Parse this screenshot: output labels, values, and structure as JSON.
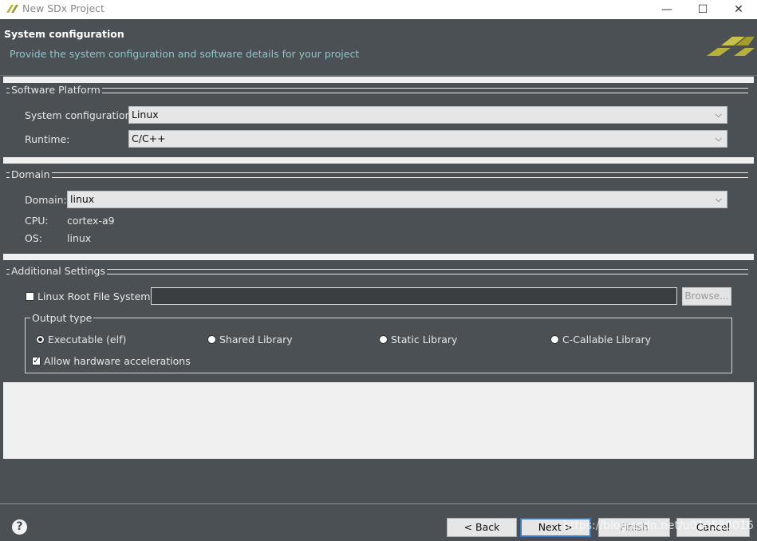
{
  "window": {
    "title": "New SDx Project",
    "minimize": "—",
    "maximize": "☐",
    "close": "✕"
  },
  "header": {
    "title": "System configuration",
    "description": "Provide the system configuration and software details for your project"
  },
  "software_platform": {
    "group_title": "Software Platform",
    "system_config_label": "System configuration:",
    "system_config_value": "Linux",
    "runtime_label": "Runtime:",
    "runtime_value": "C/C++"
  },
  "domain": {
    "group_title": "Domain",
    "domain_label": "Domain:",
    "domain_value": "linux",
    "cpu_label": "CPU:",
    "cpu_value": "cortex-a9",
    "os_label": "OS:",
    "os_value": "linux"
  },
  "additional": {
    "group_title": "Additional Settings",
    "rootfs_label": "Linux Root File System:",
    "rootfs_checked": false,
    "rootfs_value": "",
    "browse_label": "Browse...",
    "output_type_label": "Output type",
    "output_types": [
      "Executable (elf)",
      "Shared Library",
      "Static Library",
      "C-Callable Library"
    ],
    "output_selected": "Executable (elf)",
    "allow_hw_label": "Allow hardware accelerations",
    "allow_hw_checked": true
  },
  "footer": {
    "help_icon": "?",
    "back_label": "< Back",
    "next_label": "Next >",
    "finish_label": "Finish",
    "cancel_label": "Cancel",
    "watermark": "https://blog.csdn.net/u010580016"
  }
}
